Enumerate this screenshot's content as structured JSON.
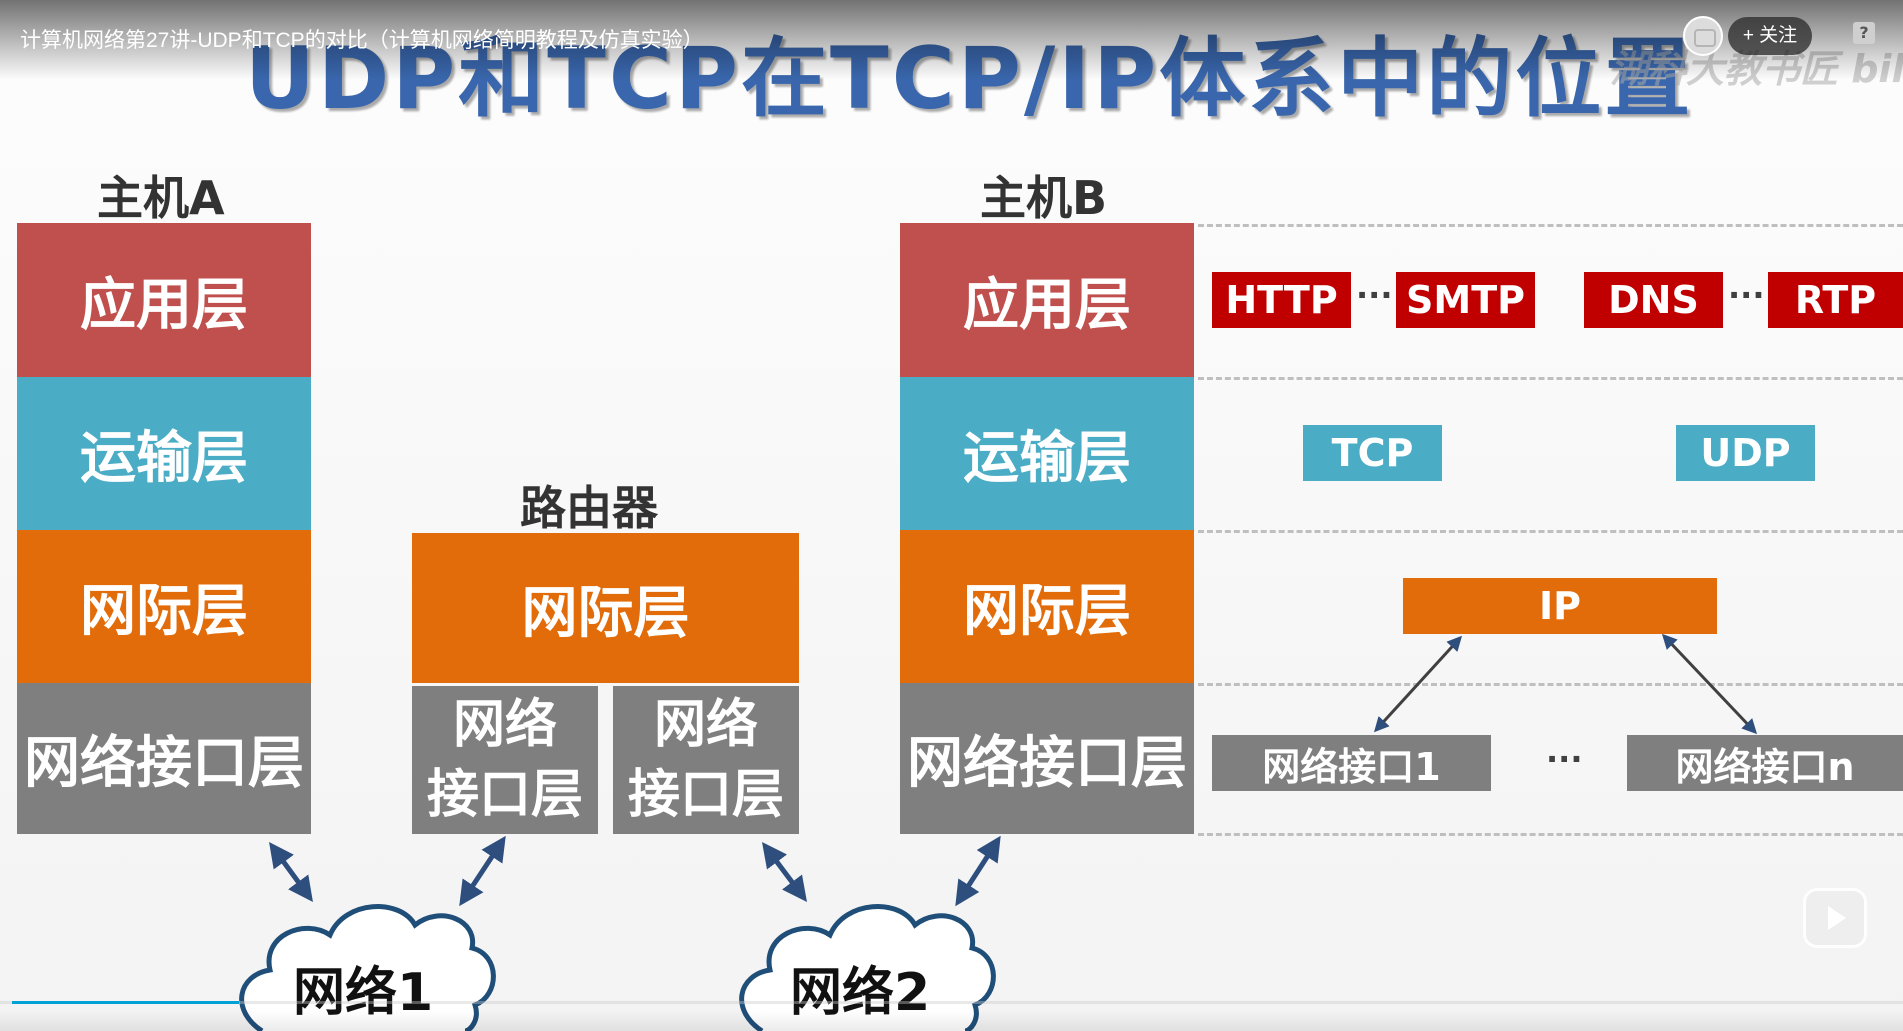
{
  "player": {
    "video_title": "计算机网络第27讲-UDP和TCP的对比（计算机网络简明教程及仿真实验）",
    "follow_label": "+ 关注",
    "help_label": "?",
    "watermark": "湖科大教书匠 bilibili",
    "progress": 0.12
  },
  "slide": {
    "title": "UDP和TCP在TCP/IP体系中的位置",
    "host_a": {
      "label": "主机A",
      "layers": [
        "应用层",
        "运输层",
        "网际层",
        "网络接口层"
      ]
    },
    "router": {
      "label": "路由器",
      "layers": [
        "网际层"
      ],
      "interfaces": [
        {
          "line1": "网络",
          "line2": "接口层"
        },
        {
          "line1": "网络",
          "line2": "接口层"
        }
      ]
    },
    "host_b": {
      "label": "主机B",
      "layers": [
        "应用层",
        "运输层",
        "网际层",
        "网络接口层"
      ]
    },
    "protocols": {
      "application": [
        "HTTP",
        "SMTP",
        "DNS",
        "RTP"
      ],
      "transport": [
        "TCP",
        "UDP"
      ],
      "internet": "IP",
      "interfaces": [
        "网络接口1",
        "网络接口n"
      ],
      "ellipsis": "···"
    },
    "networks": [
      "网络1",
      "网络2"
    ]
  },
  "colors": {
    "application": "#c0504d",
    "transport": "#4bacc6",
    "internet": "#e36c0a",
    "network_interface": "#7f7f7f",
    "protocol_red": "#c00000",
    "title_blue": "#2f5ea8",
    "arrow": "#2e4e7e"
  }
}
